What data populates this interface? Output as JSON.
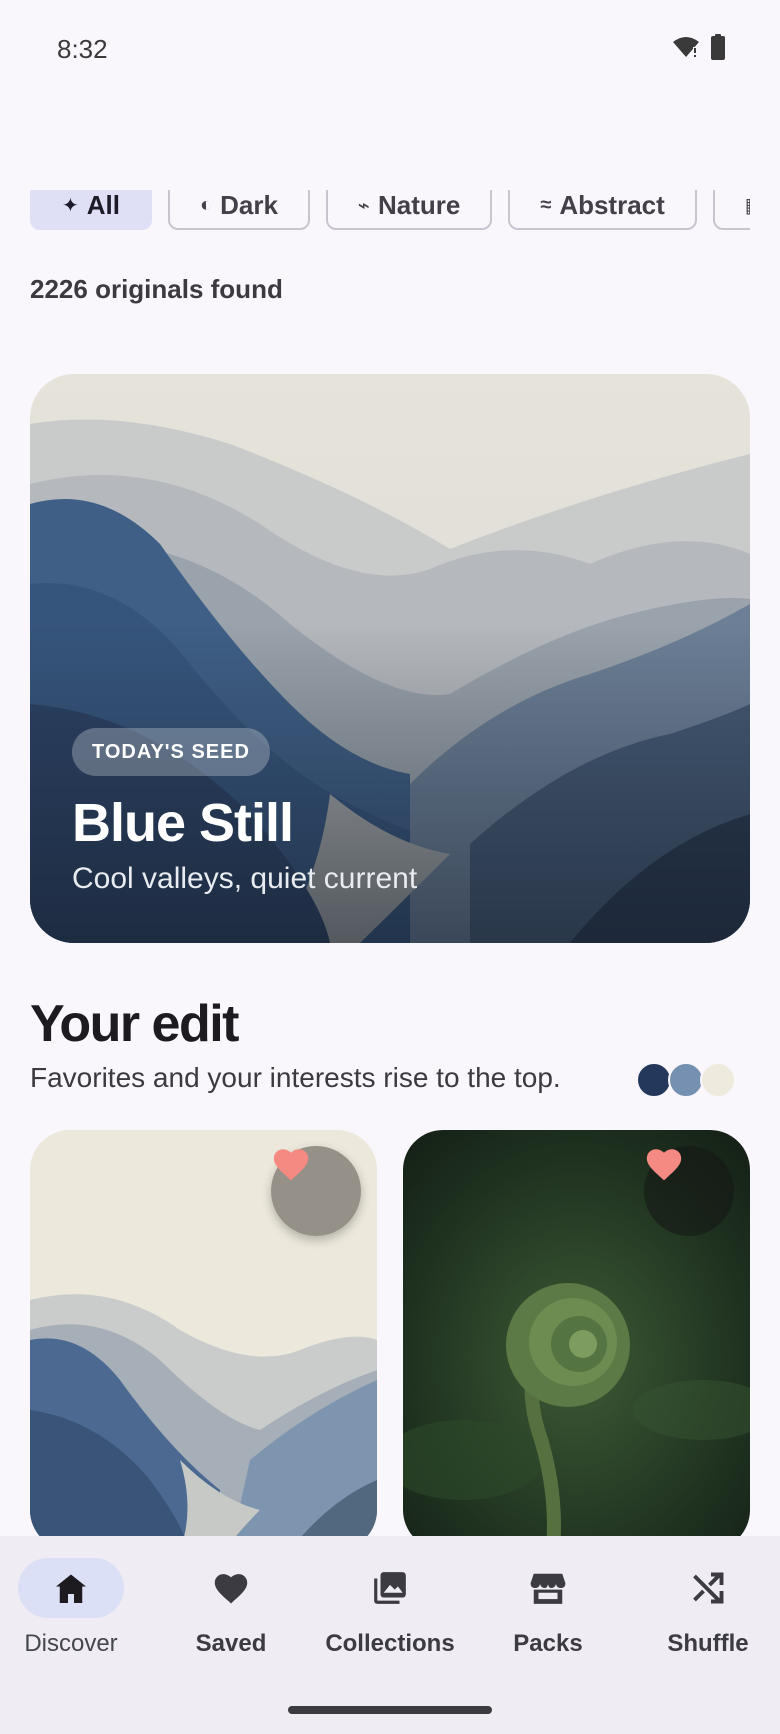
{
  "status_bar": {
    "time": "8:32"
  },
  "filters": {
    "chips": [
      {
        "glyph": "✦",
        "label": "All",
        "active": true
      },
      {
        "glyph": "◐",
        "label": "Dark",
        "active": false
      },
      {
        "glyph": "⌁",
        "label": "Nature",
        "active": false
      },
      {
        "glyph": "≈",
        "label": "Abstract",
        "active": false
      },
      {
        "glyph": "▦",
        "label": "",
        "active": false
      }
    ]
  },
  "results": {
    "count_text": "2226 originals found"
  },
  "hero": {
    "badge": "TODAY'S SEED",
    "title": "Blue Still",
    "subtitle": "Cool valleys, quiet current"
  },
  "your_edit": {
    "title": "Your edit",
    "subtitle": "Favorites and your interests rise to the top.",
    "swatches": [
      "#23385a",
      "#7590b0",
      "#eeebde"
    ]
  },
  "colors": {
    "accent_pill": "#dce0f7",
    "favorite": "#f58a82",
    "background": "#f9f6fc"
  },
  "bottom_nav": {
    "items": [
      {
        "label": "Discover",
        "icon": "home-icon",
        "active": true
      },
      {
        "label": "Saved",
        "icon": "heart-icon",
        "active": false
      },
      {
        "label": "Collections",
        "icon": "collections-icon",
        "active": false
      },
      {
        "label": "Packs",
        "icon": "store-icon",
        "active": false
      },
      {
        "label": "Shuffle",
        "icon": "shuffle-icon",
        "active": false
      }
    ]
  }
}
